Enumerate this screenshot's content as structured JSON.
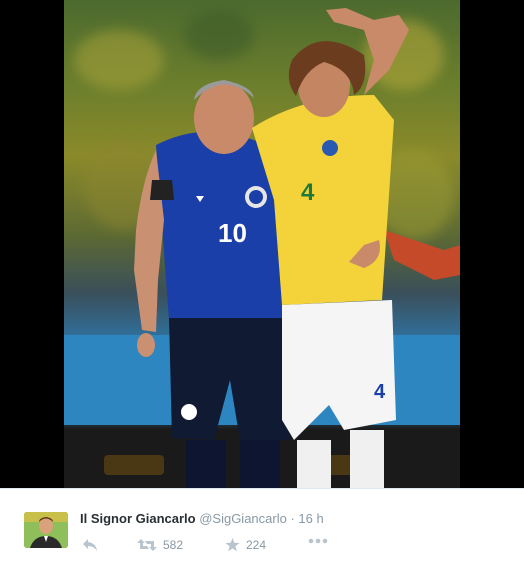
{
  "tweet": {
    "display_name": "Il Signor Giancarlo",
    "handle": "@SigGiancarlo",
    "separator": "·",
    "time": "16 h",
    "retweet_count": "582",
    "favorite_count": "224"
  },
  "photo": {
    "left_jersey_number": "10",
    "right_jersey_number": "4",
    "shorts_number": "4"
  },
  "icons": {
    "reply": "reply-icon",
    "retweet": "retweet-icon",
    "favorite": "star-icon",
    "more": "more-icon"
  },
  "colors": {
    "name": "#292f33",
    "muted": "#8899a6",
    "brazil_yellow": "#f3d23a",
    "chelsea_blue": "#1b3fa8"
  }
}
